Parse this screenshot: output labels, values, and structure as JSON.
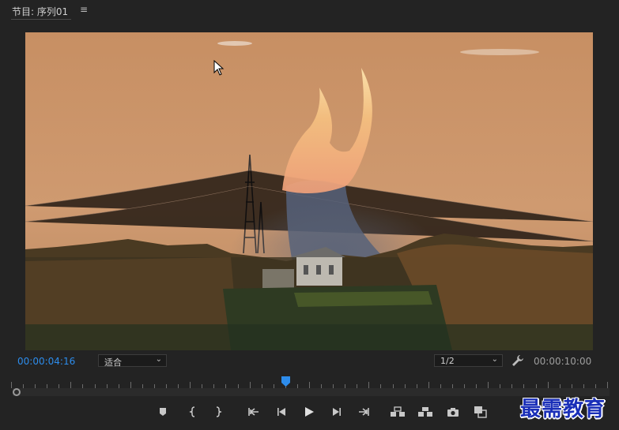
{
  "panel": {
    "title": "节目: 序列01",
    "menu_glyph": "≡"
  },
  "timecode": {
    "current": "00:00:04:16",
    "duration": "00:00:10:00"
  },
  "zoom": {
    "selected": "适合"
  },
  "resolution": {
    "selected": "1/2"
  },
  "playhead_fraction": 0.46,
  "colors": {
    "accent": "#2d8ceb",
    "panel_bg": "#232323",
    "sky": "#c89062",
    "watermark": "#1a2fb8"
  },
  "icons": {
    "marker": "marker-icon",
    "mark_in": "mark-in-icon",
    "mark_out": "mark-out-icon",
    "go_to_in": "go-to-in-icon",
    "step_back": "step-back-icon",
    "play": "play-icon",
    "step_forward": "step-forward-icon",
    "go_to_out": "go-to-out-icon",
    "lift": "lift-icon",
    "extract": "extract-icon",
    "export_frame": "camera-icon",
    "compare": "compare-view-icon",
    "settings": "wrench-icon"
  },
  "watermark": {
    "text": "最需教育"
  }
}
